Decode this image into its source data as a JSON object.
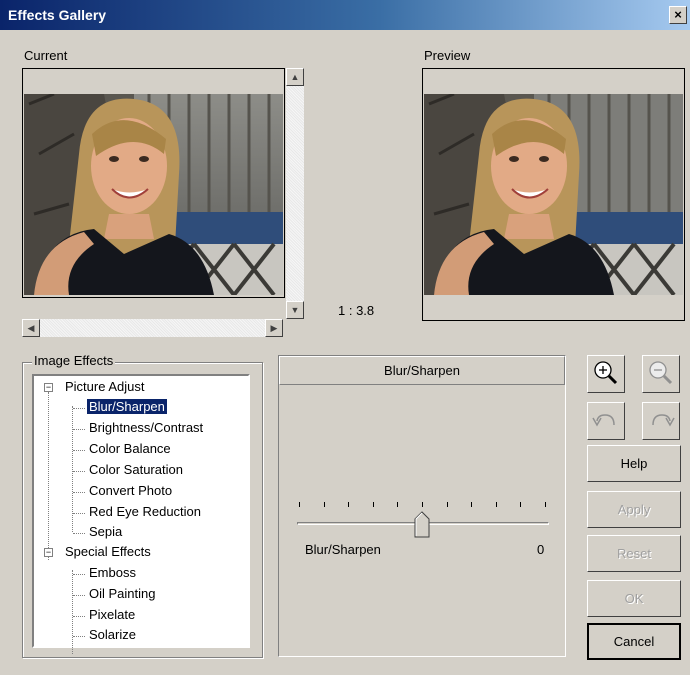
{
  "window": {
    "title": "Effects Gallery",
    "close": "×"
  },
  "current": {
    "label": "Current"
  },
  "preview": {
    "label": "Preview"
  },
  "zoom": {
    "ratio": "1 : 3.8"
  },
  "effects": {
    "group_label": "Image Effects",
    "categories": [
      {
        "label": "Picture Adjust",
        "expander": "−",
        "items": [
          "Blur/Sharpen",
          "Brightness/Contrast",
          "Color Balance",
          "Color Saturation",
          "Convert Photo",
          "Red Eye Reduction",
          "Sepia"
        ]
      },
      {
        "label": "Special Effects",
        "expander": "−",
        "items": [
          "Emboss",
          "Oil Painting",
          "Pixelate",
          "Solarize"
        ]
      }
    ],
    "selected": "Blur/Sharpen"
  },
  "settings": {
    "header": "Blur/Sharpen",
    "slider_label": "Blur/Sharpen",
    "slider_value": "0",
    "slider_position": 0.5,
    "ticks": 11
  },
  "buttons": {
    "help": "Help",
    "apply": "Apply",
    "reset": "Reset",
    "ok": "OK",
    "cancel": "Cancel"
  },
  "icons": [
    "zoom-in-icon",
    "zoom-out-icon",
    "rotate-left-icon",
    "rotate-right-icon"
  ]
}
